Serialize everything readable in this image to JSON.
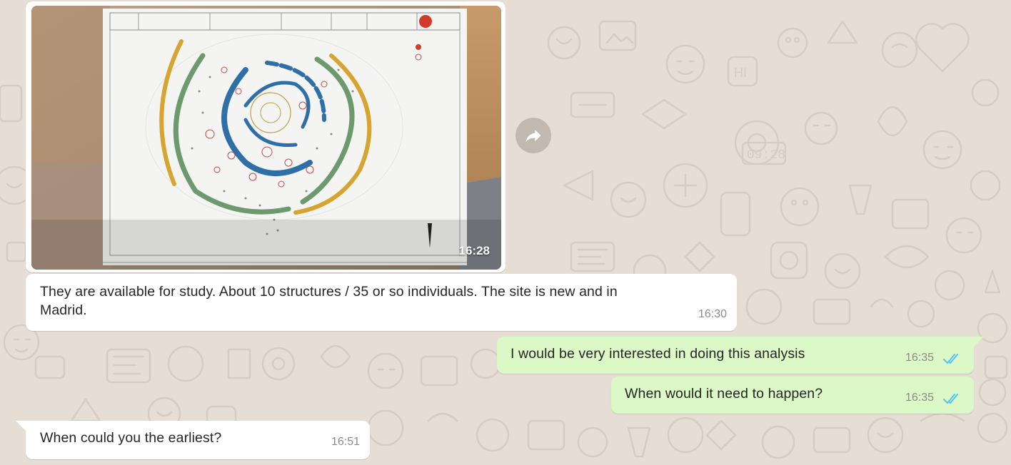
{
  "chat": {
    "messages": [
      {
        "type": "image",
        "direction": "incoming",
        "time": "16:28",
        "image_subject": "archaeological site plan"
      },
      {
        "type": "text",
        "direction": "incoming",
        "line1": "They are available for study. About 10 structures / 35 or so individuals. The site is new and in",
        "line2": "Madrid.",
        "time": "16:30"
      },
      {
        "type": "text",
        "direction": "outgoing",
        "text": "I would be very interested in doing this analysis",
        "time": "16:35",
        "status": "read"
      },
      {
        "type": "text",
        "direction": "outgoing",
        "text": "When would it need to happen?",
        "time": "16:35",
        "status": "read"
      },
      {
        "type": "text",
        "direction": "incoming",
        "text": "When could you the earliest?",
        "time": "16:51"
      }
    ]
  },
  "icons": {
    "forward": "forward-arrow-icon",
    "read_receipt": "double-check-icon"
  },
  "colors": {
    "wallpaper": "#e6ded5",
    "incoming_bubble": "#ffffff",
    "outgoing_bubble": "#dcf8c6",
    "read_ticks": "#4fc3f7",
    "timestamp": "#8a8a8a"
  }
}
